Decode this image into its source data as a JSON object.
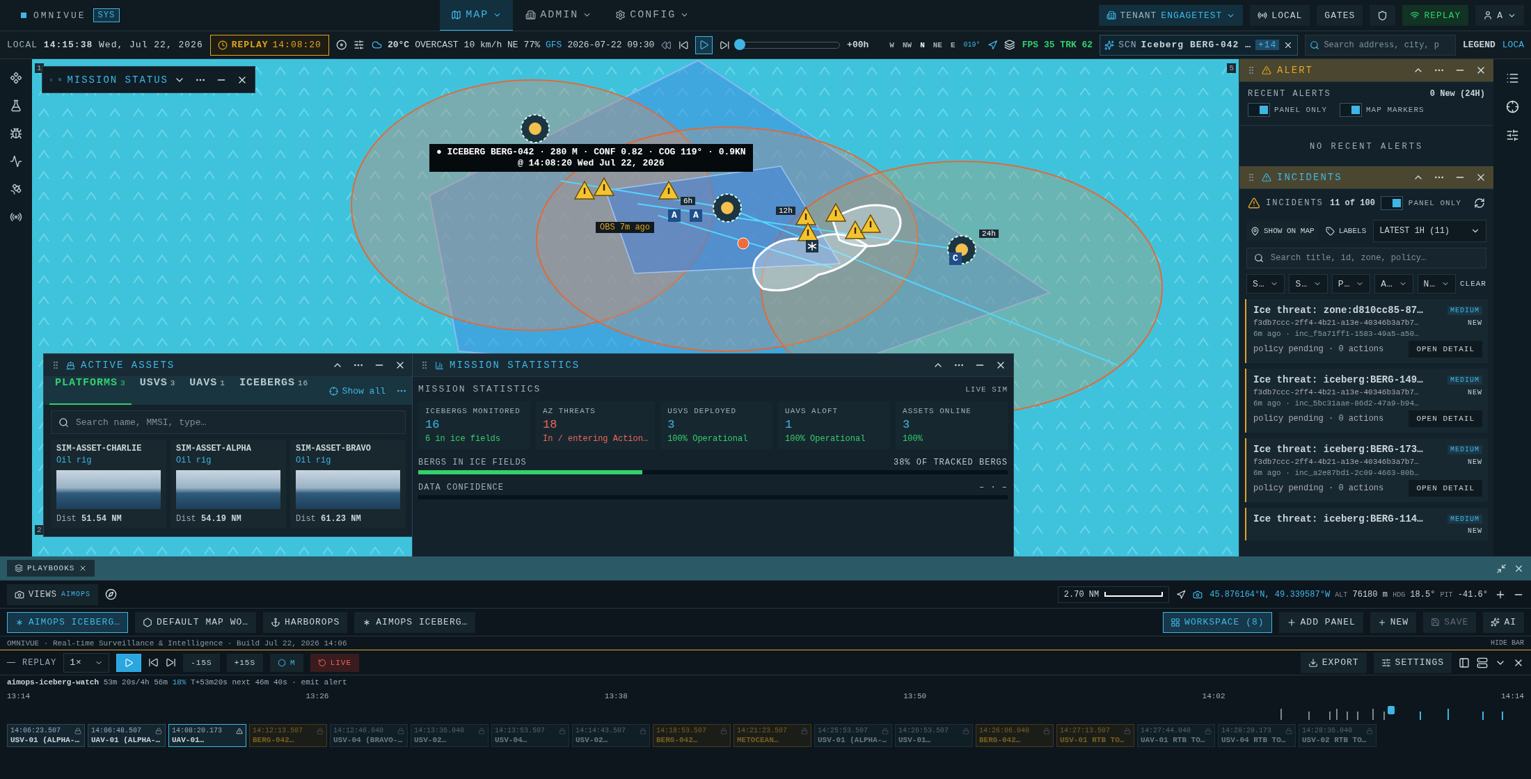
{
  "brand": {
    "name": "OMNIVUE",
    "badge": "SYS"
  },
  "nav": [
    {
      "label": "MAP",
      "selected": true
    },
    {
      "label": "ADMIN",
      "selected": false
    },
    {
      "label": "CONFIG",
      "selected": false
    }
  ],
  "top_right": {
    "tenant_label": "TENANT",
    "tenant": "ENGAGETEST",
    "local": "LOCAL",
    "gates": "GATES",
    "replay": "REPLAY",
    "user": "A"
  },
  "toolbar": {
    "local_label": "LOCAL",
    "time": "14:15:38",
    "date": "Wed, Jul 22, 2026",
    "replay_label": "REPLAY",
    "replay_time": "14:08:20",
    "temp": "20°C",
    "sky": "OVERCAST",
    "wind": "10 km/h NE",
    "humidity": "77%",
    "model": "GFS",
    "model_time": "2026-07-22 09:30",
    "playing": true,
    "time_slider": {
      "level": 0.02
    },
    "offset": "+00h",
    "compass": [
      "W",
      "NW",
      "N",
      "NE",
      "E"
    ],
    "heading": "019°",
    "fps_label": "FPS",
    "fps": "35",
    "trk_label": "TRK",
    "trk": "62",
    "scn_label": "SCN",
    "scn": "Iceberg BERG-042 …",
    "scn_count": "+14",
    "search_placeholder": "Search address, city, p",
    "legend": "LEGEND",
    "local_cut": "LOCA"
  },
  "map": {
    "edge_tags": [
      "1",
      "2",
      "5"
    ],
    "tooltip": [
      "● ICEBERG BERG-042 · 280 M · CONF 0.82 · COG 119° · 0.9KN",
      "@ 14:08:20 Wed Jul 22, 2026"
    ],
    "obs": "OBS 7m ago",
    "ring_labels": [
      "6h",
      "12h",
      "24h"
    ],
    "marker_letters": [
      "A",
      "A",
      "C"
    ]
  },
  "mission_status": {
    "title": "MISSION STATUS"
  },
  "active_assets": {
    "title": "ACTIVE ASSETS",
    "tabs": [
      {
        "label": "PLATFORMS",
        "count": "3",
        "selected": true
      },
      {
        "label": "USVS",
        "count": "3",
        "selected": false
      },
      {
        "label": "UAVS",
        "count": "1",
        "selected": false
      },
      {
        "label": "ICEBERGS",
        "count": "16",
        "selected": false
      }
    ],
    "show_all": "Show all",
    "search_placeholder": "Search name, MMSI, type…",
    "cards": [
      {
        "name": "SIM-ASSET-CHARLIE",
        "type": "Oil rig",
        "dist_label": "Dist",
        "dist": "51.54 NM"
      },
      {
        "name": "SIM-ASSET-ALPHA",
        "type": "Oil rig",
        "dist_label": "Dist",
        "dist": "54.19 NM"
      },
      {
        "name": "SIM-ASSET-BRAVO",
        "type": "Oil rig",
        "dist_label": "Dist",
        "dist": "61.23 NM"
      }
    ]
  },
  "mission_statistics": {
    "title": "MISSION STATISTICS",
    "heading": "MISSION STATISTICS",
    "mode": "LIVE SIM",
    "stats": [
      {
        "label": "ICEBERGS MONITORED",
        "value": "16",
        "note": "6 in ice fields",
        "alert": false
      },
      {
        "label": "AZ THREATS",
        "value": "18",
        "note": "In / entering Action…",
        "alert": true
      },
      {
        "label": "USVS DEPLOYED",
        "value": "3",
        "note": "100% Operational",
        "alert": false
      },
      {
        "label": "UAVS ALOFT",
        "value": "1",
        "note": "100% Operational",
        "alert": false
      },
      {
        "label": "ASSETS ONLINE",
        "value": "3",
        "note": "100%",
        "alert": false
      }
    ],
    "bars": [
      {
        "label": "BERGS IN ICE FIELDS",
        "reading": "38% OF TRACKED BERGS",
        "level": 0.38
      },
      {
        "label": "DATA CONFIDENCE",
        "reading": "– · –"
      }
    ]
  },
  "alert": {
    "title": "ALERT",
    "heading": "RECENT ALERTS",
    "new_count": "0 New (24H)",
    "toggles": [
      {
        "label": "PANEL ONLY",
        "on": true
      },
      {
        "label": "MAP MARKERS",
        "on": true
      }
    ],
    "empty": "NO RECENT ALERTS"
  },
  "incidents": {
    "title": "INCIDENTS",
    "count_label": "INCIDENTS",
    "count": "11 of 100",
    "toggle": {
      "label": "PANEL ONLY",
      "on": true
    },
    "show_on_map": "SHOW ON MAP",
    "labels": "LABELS",
    "range": "LATEST 1H (11)",
    "search_placeholder": "Search title, id, zone, policy…",
    "filters": [
      "S…",
      "S…",
      "P…",
      "A…",
      "N…"
    ],
    "clear": "CLEAR",
    "items": [
      {
        "title": "Ice threat: zone:d810cc85-87…",
        "id": "f3db7ccc-2ff4-4b21-a13e-40346b3a7b7…",
        "meta": "6m ago · inc_f5a71ff1-1583-49a5-a50…",
        "policy": "policy pending · 0 actions",
        "severity": "MEDIUM",
        "status": "NEW",
        "button": "OPEN DETAIL"
      },
      {
        "title": "Ice threat: iceberg:BERG-149…",
        "id": "f3db7ccc-2ff4-4b21-a13e-40346b3a7b7…",
        "meta": "6m ago · inc_5bc31aae-86d2-47a9-b94…",
        "policy": "policy pending · 0 actions",
        "severity": "MEDIUM",
        "status": "NEW",
        "button": "OPEN DETAIL"
      },
      {
        "title": "Ice threat: iceberg:BERG-173…",
        "id": "f3db7ccc-2ff4-4b21-a13e-40346b3a7b7…",
        "meta": "6m ago · inc_a2e87bd1-2c09-4663-80b…",
        "policy": "policy pending · 0 actions",
        "severity": "MEDIUM",
        "status": "NEW",
        "button": "OPEN DETAIL"
      },
      {
        "title": "Ice threat: iceberg:BERG-114…",
        "severity": "MEDIUM",
        "status": "NEW"
      }
    ]
  },
  "playbooks": {
    "label": "PLAYBOOKS"
  },
  "views": {
    "label": "VIEWS",
    "tag": "AIMOPS",
    "scale": "2.70 NM",
    "coords": "45.876164°N, 49.339587°W",
    "alt_label": "ALT",
    "alt": "76180 m",
    "hdg_label": "HDG",
    "hdg": "18.5°",
    "pit_label": "PIT",
    "pit": "-41.6°"
  },
  "workspaces": [
    {
      "label": "AIMOPS ICEBERG…",
      "selected": true
    },
    {
      "label": "DEFAULT MAP WO…",
      "selected": false
    },
    {
      "label": "HARBOROPS",
      "selected": false
    },
    {
      "label": "AIMOPS ICEBERG…",
      "selected": false
    }
  ],
  "workspace_actions": {
    "workspace": "WORKSPACE",
    "count": "(8)",
    "add": "ADD PANEL",
    "new": "NEW",
    "save": "SAVE",
    "ai": "AI"
  },
  "footer": {
    "text": "OMNIVUE · Real-time Surveillance & Intelligence · Build Jul 22, 2026 14:06",
    "hide": "HIDE BAR"
  },
  "replay": {
    "label": "REPLAY",
    "speed": "1×",
    "back": "-15S",
    "fwd": "+15S",
    "marker": "M",
    "live": "LIVE",
    "export": "EXPORT",
    "settings": "SETTINGS"
  },
  "timeline": {
    "name": "aimops-iceberg-watch",
    "elapsed": "53m 20s/4h 56m",
    "percent": "18%",
    "offset": "T+53m20s",
    "next": "next 46m 40s · emit alert",
    "ticks": [
      "13:14",
      "13:26",
      "13:38",
      "13:50",
      "14:02",
      "14:14"
    ],
    "level": 0.91,
    "events": [
      {
        "time": "14:06:23.507",
        "label": "USV-01 (ALPHA-…",
        "selected": false,
        "future": false,
        "alert": false
      },
      {
        "time": "14:06:48.507",
        "label": "UAV-01 (ALPHA-…",
        "selected": false,
        "future": false,
        "alert": false
      },
      {
        "time": "14:08:20.173",
        "label": "UAV-01…",
        "selected": true,
        "future": false,
        "alert": false
      },
      {
        "time": "14:12:13.507",
        "label": "BERG-042…",
        "selected": false,
        "future": true,
        "alert": true
      },
      {
        "time": "14:12:46.040",
        "label": "USV-04 (BRAVO-…",
        "selected": false,
        "future": true,
        "alert": false
      },
      {
        "time": "14:13:36.040",
        "label": "USV-02…",
        "selected": false,
        "future": true,
        "alert": false
      },
      {
        "time": "14:13:53.507",
        "label": "USV-04…",
        "selected": false,
        "future": true,
        "alert": false
      },
      {
        "time": "14:14:43.507",
        "label": "USV-02…",
        "selected": false,
        "future": true,
        "alert": false
      },
      {
        "time": "14:18:53.507",
        "label": "BERG-042…",
        "selected": false,
        "future": true,
        "alert": true
      },
      {
        "time": "14:21:23.507",
        "label": "METOCEAN…",
        "selected": false,
        "future": true,
        "alert": true
      },
      {
        "time": "14:25:53.507",
        "label": "USV-01 (ALPHA-…",
        "selected": false,
        "future": true,
        "alert": false
      },
      {
        "time": "14:26:53.507",
        "label": "USV-01…",
        "selected": false,
        "future": true,
        "alert": false
      },
      {
        "time": "14:26:06.040",
        "label": "BERG-042…",
        "selected": false,
        "future": true,
        "alert": true
      },
      {
        "time": "14:27:13.507",
        "label": "USV-01 RTB TO…",
        "selected": false,
        "future": true,
        "alert": true
      },
      {
        "time": "14:27:44.040",
        "label": "UAV-01 RTB TO…",
        "selected": false,
        "future": true,
        "alert": false
      },
      {
        "time": "14:28:20.173",
        "label": "USV-04 RTB TO…",
        "selected": false,
        "future": true,
        "alert": false
      },
      {
        "time": "14:28:36.040",
        "label": "USV-02 RTB TO…",
        "selected": false,
        "future": true,
        "alert": false
      }
    ]
  }
}
